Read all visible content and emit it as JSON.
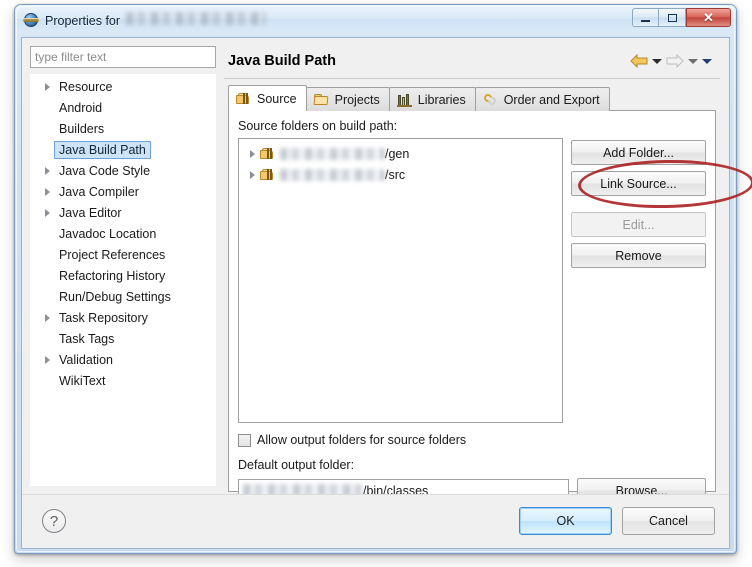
{
  "window": {
    "title_prefix": "Properties for",
    "title_project_blurred": true,
    "icon": "eclipse-globe-icon",
    "buttons": {
      "minimize": "minimize",
      "maximize": "restore",
      "close": "✕"
    }
  },
  "sidebar": {
    "filter_placeholder": "type filter text",
    "filter_value": "",
    "items": [
      {
        "label": "Resource",
        "expandable": true,
        "selected": false
      },
      {
        "label": "Android",
        "expandable": false,
        "selected": false
      },
      {
        "label": "Builders",
        "expandable": false,
        "selected": false
      },
      {
        "label": "Java Build Path",
        "expandable": false,
        "selected": true
      },
      {
        "label": "Java Code Style",
        "expandable": true,
        "selected": false
      },
      {
        "label": "Java Compiler",
        "expandable": true,
        "selected": false
      },
      {
        "label": "Java Editor",
        "expandable": true,
        "selected": false
      },
      {
        "label": "Javadoc Location",
        "expandable": false,
        "selected": false
      },
      {
        "label": "Project References",
        "expandable": false,
        "selected": false
      },
      {
        "label": "Refactoring History",
        "expandable": false,
        "selected": false
      },
      {
        "label": "Run/Debug Settings",
        "expandable": false,
        "selected": false
      },
      {
        "label": "Task Repository",
        "expandable": true,
        "selected": false
      },
      {
        "label": "Task Tags",
        "expandable": false,
        "selected": false
      },
      {
        "label": "Validation",
        "expandable": true,
        "selected": false
      },
      {
        "label": "WikiText",
        "expandable": false,
        "selected": false
      }
    ]
  },
  "page": {
    "title": "Java Build Path",
    "nav": {
      "back": "back-arrow",
      "back_menu": "chevron-down",
      "forward": "forward-arrow",
      "forward_menu": "chevron-down",
      "view_menu": "chevron-down"
    },
    "tabs": [
      {
        "label": "Source",
        "icon": "package-folder-icon",
        "active": true
      },
      {
        "label": "Projects",
        "icon": "folder-icon",
        "active": false
      },
      {
        "label": "Libraries",
        "icon": "books-icon",
        "active": false
      },
      {
        "label": "Order and Export",
        "icon": "order-arrows-icon",
        "active": false
      }
    ],
    "source_tab": {
      "list_label": "Source folders on build path:",
      "entries": [
        {
          "name_blurred": true,
          "suffix": "/gen",
          "icon": "source-folder-icon",
          "expandable": true
        },
        {
          "name_blurred": true,
          "suffix": "/src",
          "icon": "source-folder-icon",
          "expandable": true
        }
      ],
      "buttons": [
        {
          "label": "Add Folder...",
          "enabled": true
        },
        {
          "label": "Link Source...",
          "enabled": true,
          "highlighted": true
        },
        {
          "label": "Edit...",
          "enabled": false
        },
        {
          "label": "Remove",
          "enabled": true
        }
      ],
      "allow_output_folders": {
        "label": "Allow output folders for source folders",
        "checked": false
      },
      "default_output": {
        "label": "Default output folder:",
        "value_blurred": true,
        "value_suffix": "/bin/classes",
        "browse_label": "Browse..."
      }
    }
  },
  "footer": {
    "help": "?",
    "ok_label": "OK",
    "cancel_label": "Cancel"
  },
  "annotation": {
    "shape": "ellipse",
    "color": "#a81b1b",
    "targets": "Link Source... button"
  }
}
